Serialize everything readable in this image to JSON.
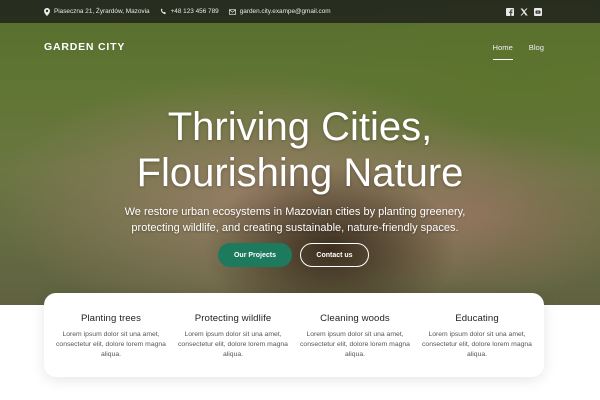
{
  "topbar": {
    "address": "Piaseczna 21, Żyrardów, Mazovia",
    "phone": "+48 123 456 789",
    "email": "garden.city.exampe@gmail.com",
    "socials": [
      "facebook-icon",
      "x-icon",
      "youtube-icon"
    ]
  },
  "nav": {
    "logo": "GARDEN CITY",
    "items": [
      {
        "label": "Home",
        "active": true
      },
      {
        "label": "Blog",
        "active": false
      }
    ]
  },
  "hero": {
    "title_line1": "Thriving Cities,",
    "title_line2": "Flourishing Nature",
    "subtitle": "We restore urban ecosystems in Mazovian cities by planting greenery, protecting wildlife, and creating sustainable, nature-friendly spaces.",
    "primary_button": "Our Projects",
    "secondary_button": "Contact us"
  },
  "features": [
    {
      "title": "Planting trees",
      "text": "Lorem ipsum dolor sit una amet, consectetur elit, dolore lorem magna aliqua."
    },
    {
      "title": "Protecting wildlife",
      "text": "Lorem ipsum dolor sit una amet, consectetur elit, dolore lorem magna aliqua."
    },
    {
      "title": "Cleaning woods",
      "text": "Lorem ipsum dolor sit una amet, consectetur elit, dolore lorem magna aliqua."
    },
    {
      "title": "Educating",
      "text": "Lorem ipsum dolor sit una amet, consectetur elit, dolore lorem magna aliqua."
    }
  ],
  "colors": {
    "accent": "#1d7a5d",
    "topbar": "#1e201c",
    "card": "#ffffff"
  }
}
